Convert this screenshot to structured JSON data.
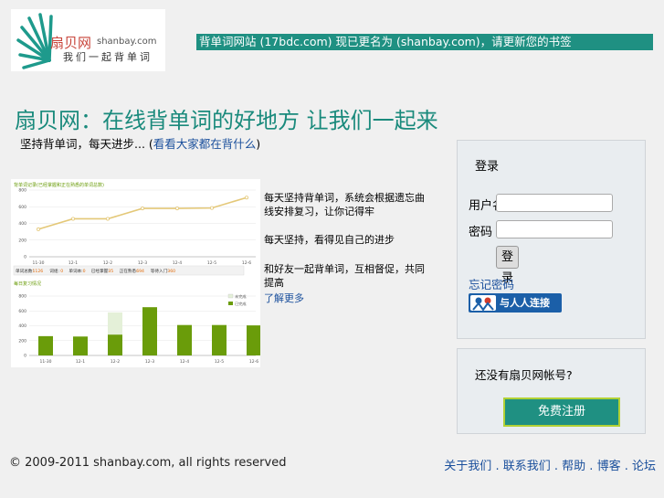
{
  "logo": {
    "name_cn": "扇贝网",
    "name_en": "shanbay.com",
    "slogan": "我们一起背单词"
  },
  "banner": "背单词网站 (17bdc.com) 现已更名为 (shanbay.com)，请更新您的书签",
  "headline": "扇贝网：在线背单词的好地方 让我们一起来",
  "subline": {
    "prefix": "坚持背单词，每天进步...",
    "link": "看看大家都在背什么"
  },
  "chart": {
    "line_title": "背单词记录(已经掌握和正在熟悉的单词总数)",
    "line_categories": [
      "11-30",
      "12-1",
      "12-2",
      "12-3",
      "12-4",
      "12-5",
      "12-6"
    ],
    "line_values": [
      330,
      455,
      455,
      580,
      580,
      585,
      710
    ],
    "line_ylim": [
      0,
      800
    ],
    "stats": [
      {
        "label": "单词总数:",
        "value": "1126"
      },
      {
        "label": "词组:",
        "value": "0"
      },
      {
        "label": "单词本:",
        "value": "0"
      },
      {
        "label": "已经掌握:",
        "value": "35"
      },
      {
        "label": "正在熟悉:",
        "value": "694"
      },
      {
        "label": "等待入门:",
        "value": "360"
      }
    ],
    "bar_title": "每日复习情况",
    "bar_categories": [
      "11-30",
      "12-1",
      "12-2",
      "12-3",
      "12-4",
      "12-5",
      "12-6"
    ],
    "bar_values": [
      260,
      255,
      280,
      650,
      410,
      410,
      405
    ],
    "bar_ghost": [
      0,
      0,
      580,
      0,
      0,
      0,
      0
    ],
    "bar_ylim": [
      0,
      800
    ],
    "legend": [
      "未完成",
      "已完成"
    ],
    "colors": {
      "line": "#e4c878",
      "bar": "#6a9c0a",
      "ghost": "#e4f0d8"
    }
  },
  "features": [
    "每天坚持背单词，系统会根据遗忘曲线安排复习，让你记得牢",
    "每天坚持，看得见自己的进步",
    "和好友一起背单词，互相督促，共同提高"
  ],
  "more_link": "了解更多",
  "login": {
    "title": "登录",
    "username_label": "用户名",
    "password_label": "密码",
    "submit": "登录",
    "register_link": "忘记密码",
    "renren": "与人人连接"
  },
  "signup": {
    "question": "还没有扇贝网帐号?",
    "button": "免费注册"
  },
  "footer": {
    "copyright": "© 2009-2011 shanbay.com, all rights reserved",
    "links": [
      "关于我们",
      "联系我们",
      "帮助",
      "博客",
      "论坛"
    ]
  }
}
